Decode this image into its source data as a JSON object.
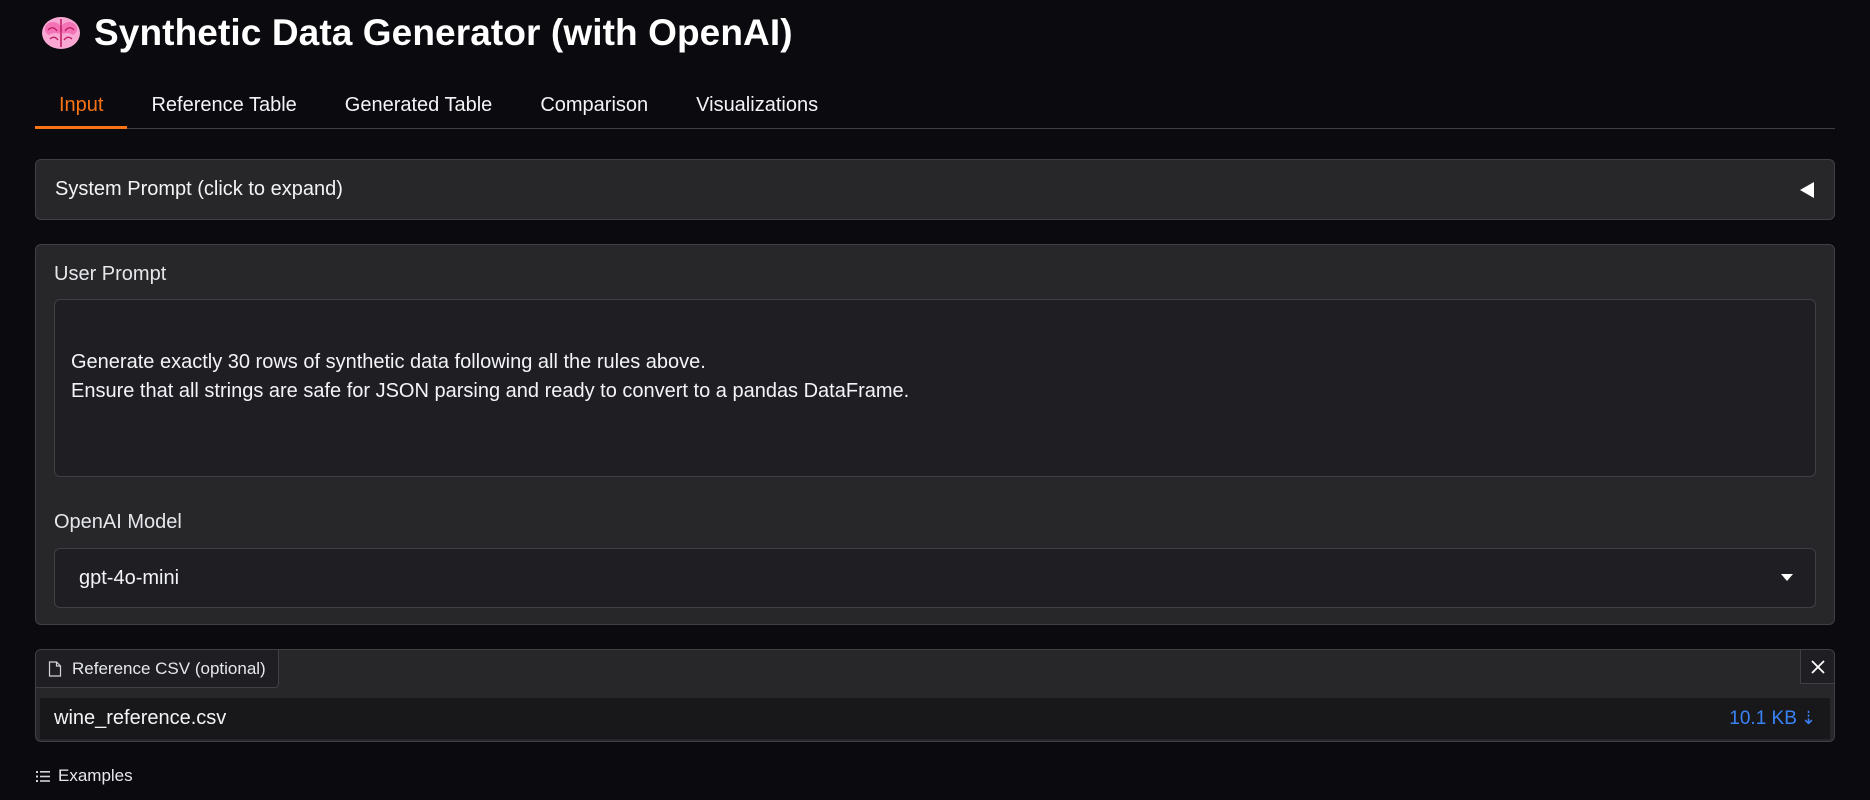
{
  "app": {
    "title": "Synthetic Data Generator (with OpenAI)",
    "icon": "brain-icon"
  },
  "tabs": [
    {
      "label": "Input",
      "active": true
    },
    {
      "label": "Reference Table",
      "active": false
    },
    {
      "label": "Generated Table",
      "active": false
    },
    {
      "label": "Comparison",
      "active": false
    },
    {
      "label": "Visualizations",
      "active": false
    }
  ],
  "system_prompt": {
    "label": "System Prompt (click to expand)",
    "icon": "caret-left-icon"
  },
  "user_prompt": {
    "label": "User Prompt",
    "value": "Generate exactly 30 rows of synthetic data following all the rules above.\nEnsure that all strings are safe for JSON parsing and ready to convert to a pandas DataFrame."
  },
  "model": {
    "label": "OpenAI Model",
    "selected": "gpt-4o-mini"
  },
  "reference_csv": {
    "label": "Reference CSV (optional)",
    "file_name": "wine_reference.csv",
    "file_size": "10.1 KB",
    "download_glyph": "⇣"
  },
  "examples": {
    "label": "Examples"
  },
  "colors": {
    "background": "#0b0b0f",
    "panel": "#27272a",
    "accent": "#f97316",
    "link": "#3b82f6"
  }
}
